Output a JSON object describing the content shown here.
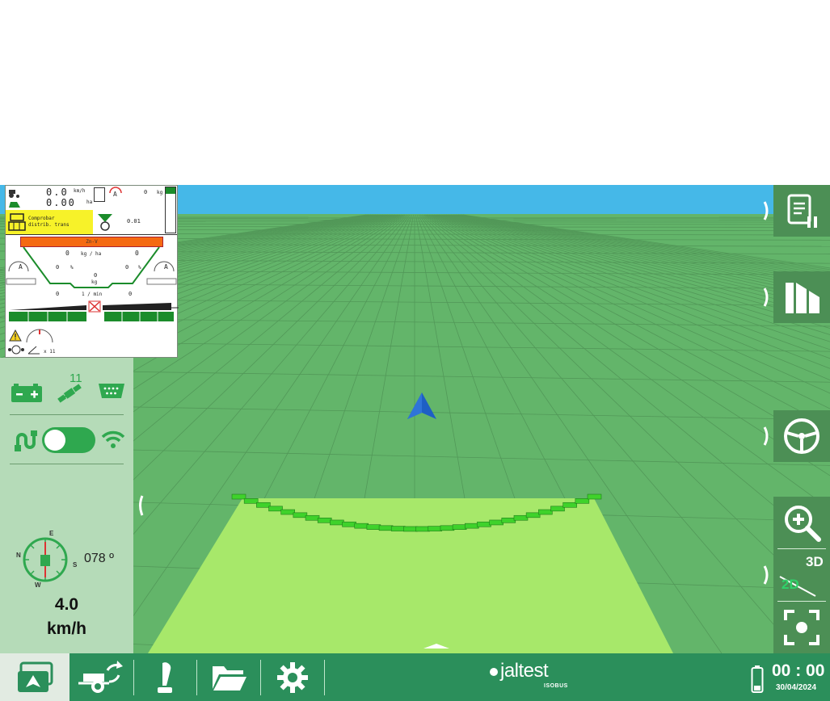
{
  "isobus": {
    "speed_value": "0.0",
    "speed_unit": "km/h",
    "area_value": "0.00",
    "area_unit": "ha",
    "weight_value": "0",
    "weight_unit": "kg",
    "message_line1": "Comprobar",
    "message_line2": "distrib. trans",
    "rate_display": "0.01",
    "product_name": "Zn-V",
    "rate_target": "0",
    "rate_unit": "kg / ha",
    "rate_current": "0",
    "left_percent": "0",
    "right_percent": "0",
    "percent_unit": "%",
    "center_value": "0",
    "center_unit": "kg",
    "rpm_left": "0",
    "rpm_unit": "1 / min",
    "rpm_right": "0",
    "tilt_multiplier": "x 11",
    "auto_label": "A"
  },
  "status": {
    "satellites": "11",
    "connection_toggle": "off",
    "heading": "078 º",
    "speed": "4.0",
    "speed_unit": "km/h",
    "compass": {
      "n": "N",
      "e": "E",
      "s": "S",
      "w": "W"
    }
  },
  "right_panel": {
    "view_toggle_3d": "3D",
    "view_toggle_2d": "2D"
  },
  "bottom_bar": {
    "brand": "jaltest",
    "brand_sub": "ISOBUS",
    "clock": "00 : 00",
    "date": "30/04/2024"
  },
  "colors": {
    "sky": "#45b8e8",
    "field": "#63b56a",
    "coverage": "#a7e86a",
    "boom_sections": "#3fd22b",
    "vehicle_arrow": "#1e5fc4",
    "status_panel": "#b5dbb8",
    "toolbar": "#2b8f5b",
    "right_buttons": "#4c8f55",
    "warning_yellow": "#f7f229",
    "product_orange": "#f56a12"
  },
  "icons": [
    "journal-pause-icon",
    "sections-icon",
    "steering-wheel-icon",
    "zoom-in-icon",
    "view-2d-3d-icon",
    "center-view-icon",
    "battery-icon",
    "satellite-icon",
    "serial-port-icon",
    "plug-icon",
    "wifi-icon",
    "compass-icon",
    "map-view-icon",
    "implement-icon",
    "joystick-icon",
    "folder-icon",
    "gear-icon",
    "battery-status-icon"
  ]
}
